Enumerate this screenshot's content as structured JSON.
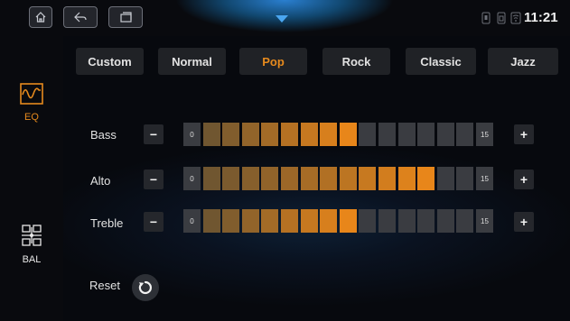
{
  "statusbar": {
    "home_icon": "home-icon",
    "back_icon": "back-icon",
    "recents_icon": "recents-icon",
    "time": "11:21"
  },
  "sidebar": {
    "items": [
      {
        "label": "EQ",
        "icon": "equalizer-wave-icon",
        "active": true
      },
      {
        "label": "BAL",
        "icon": "speaker-balance-icon",
        "active": false
      }
    ]
  },
  "presets": [
    {
      "label": "Custom"
    },
    {
      "label": "Normal"
    },
    {
      "label": "Pop",
      "active": true
    },
    {
      "label": "Rock"
    },
    {
      "label": "Classic"
    },
    {
      "label": "Jazz"
    }
  ],
  "bands": [
    {
      "label": "Bass",
      "level": 8,
      "min": "0",
      "max": "15",
      "minus": "−",
      "plus": "+"
    },
    {
      "label": "Alto",
      "level": 12,
      "min": "0",
      "max": "15",
      "minus": "−",
      "plus": "+"
    },
    {
      "label": "Treble",
      "level": 8,
      "min": "0",
      "max": "15",
      "minus": "−",
      "plus": "+"
    }
  ],
  "reset": {
    "label": "Reset"
  },
  "colors": {
    "accent": "#e68a1d",
    "segment_inactive": "#3a3c41"
  }
}
